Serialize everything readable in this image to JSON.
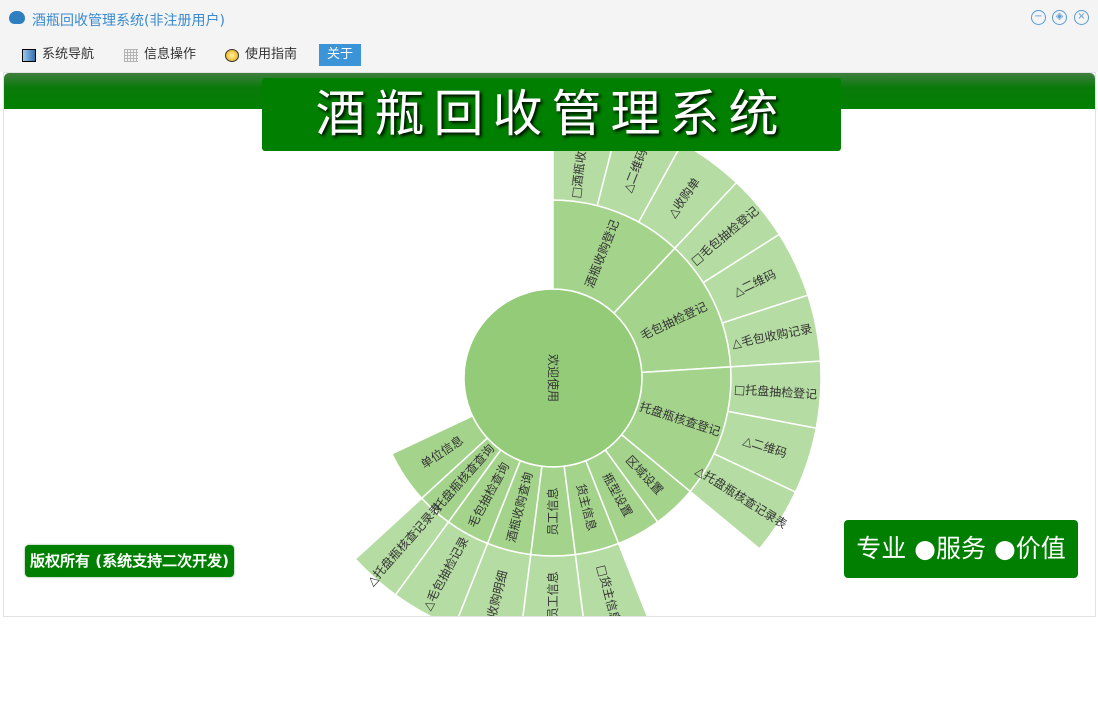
{
  "window": {
    "title": "酒瓶回收管理系统(非注册用户)",
    "controls": [
      "minimize",
      "restore",
      "close"
    ]
  },
  "menu": [
    {
      "label": "系统导航",
      "icon": "window-icon"
    },
    {
      "label": "信息操作",
      "icon": "grid-icon"
    },
    {
      "label": "使用指南",
      "icon": "help-icon"
    },
    {
      "label": "关于",
      "active": true
    }
  ],
  "banner": {
    "title": "酒瓶回收管理系统"
  },
  "footer": {
    "copyright": "版权所有 (系统支持二次开发)",
    "slogan": "专业 ●服务 ●价值"
  },
  "colors": {
    "header_green": "#008000",
    "ring0": "#93cb78",
    "ring1": "#a4d48c",
    "ring2": "#b5dca2",
    "accent": "#3b93d8"
  },
  "sunburst": {
    "root": "欢迎使用",
    "children": [
      {
        "name": "酒瓶收购登记",
        "children": [
          {
            "name": "□酒瓶收购记录",
            "value": 1
          },
          {
            "name": "△二维码",
            "value": 1
          },
          {
            "name": "△收购单",
            "value": 1
          }
        ]
      },
      {
        "name": "毛包抽检登记",
        "children": [
          {
            "name": "□毛包抽检登记",
            "value": 1
          },
          {
            "name": "△二维码",
            "value": 1
          },
          {
            "name": "△毛包收购记录",
            "value": 1
          }
        ]
      },
      {
        "name": "托盘瓶核查登记",
        "children": [
          {
            "name": "□托盘抽检登记",
            "value": 1
          },
          {
            "name": "△二维码",
            "value": 1
          },
          {
            "name": "△托盘瓶核查记录表",
            "value": 1
          }
        ]
      },
      {
        "name": "区域设置",
        "value": 1
      },
      {
        "name": "瓶型设置",
        "value": 1
      },
      {
        "name": "货主信息",
        "children": [
          {
            "name": "□货主信息",
            "value": 1
          }
        ]
      },
      {
        "name": "员工信息",
        "children": [
          {
            "name": "□员工信息",
            "value": 1
          }
        ]
      },
      {
        "name": "酒瓶收购查询",
        "children": [
          {
            "name": "收购明细",
            "value": 1
          }
        ]
      },
      {
        "name": "毛包抽检查询",
        "children": [
          {
            "name": "△毛包抽检记录",
            "value": 1
          }
        ]
      },
      {
        "name": "托盘瓶核查查询",
        "children": [
          {
            "name": "△托盘瓶核查记录表",
            "value": 0.8
          }
        ]
      },
      {
        "name": "单位信息",
        "value": 1.2
      }
    ]
  }
}
